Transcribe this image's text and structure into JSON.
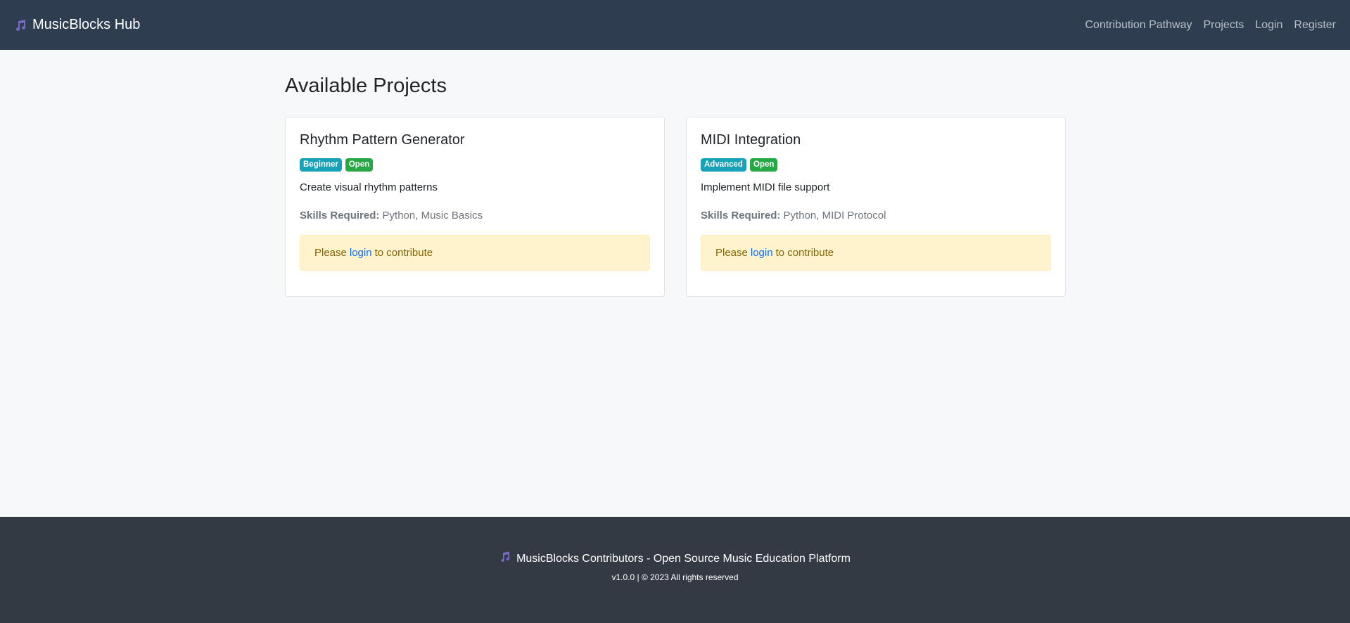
{
  "nav": {
    "brand": "MusicBlocks Hub",
    "brand_icon": "music-note-icon",
    "links": [
      "Contribution Pathway",
      "Projects",
      "Login",
      "Register"
    ]
  },
  "main": {
    "title": "Available Projects",
    "projects": [
      {
        "title": "Rhythm Pattern Generator",
        "badges": [
          "Beginner",
          "Open"
        ],
        "description": "Create visual rhythm patterns",
        "skills_label": "Skills Required:",
        "skills": "Python, Music Basics",
        "alert_prefix": "Please",
        "alert_link": "login",
        "alert_suffix": "to contribute"
      },
      {
        "title": "MIDI Integration",
        "badges": [
          "Advanced",
          "Open"
        ],
        "description": "Implement MIDI file support",
        "skills_label": "Skills Required:",
        "skills": "Python, MIDI Protocol",
        "alert_prefix": "Please",
        "alert_link": "login",
        "alert_suffix": "to contribute"
      }
    ]
  },
  "footer": {
    "icon": "music-notes-icon",
    "text": "MusicBlocks Contributors - Open Source Music Education Platform",
    "sub": "v1.0.0 | © 2023 All rights reserved"
  },
  "colors": {
    "navbar": "#2e3d50",
    "footer": "#343a44",
    "badge_info": "#17a2b8",
    "badge_success": "#28a745",
    "link": "#0d6efd",
    "alert_bg": "#fff3cd",
    "icon_purple": "#7b68c8"
  }
}
